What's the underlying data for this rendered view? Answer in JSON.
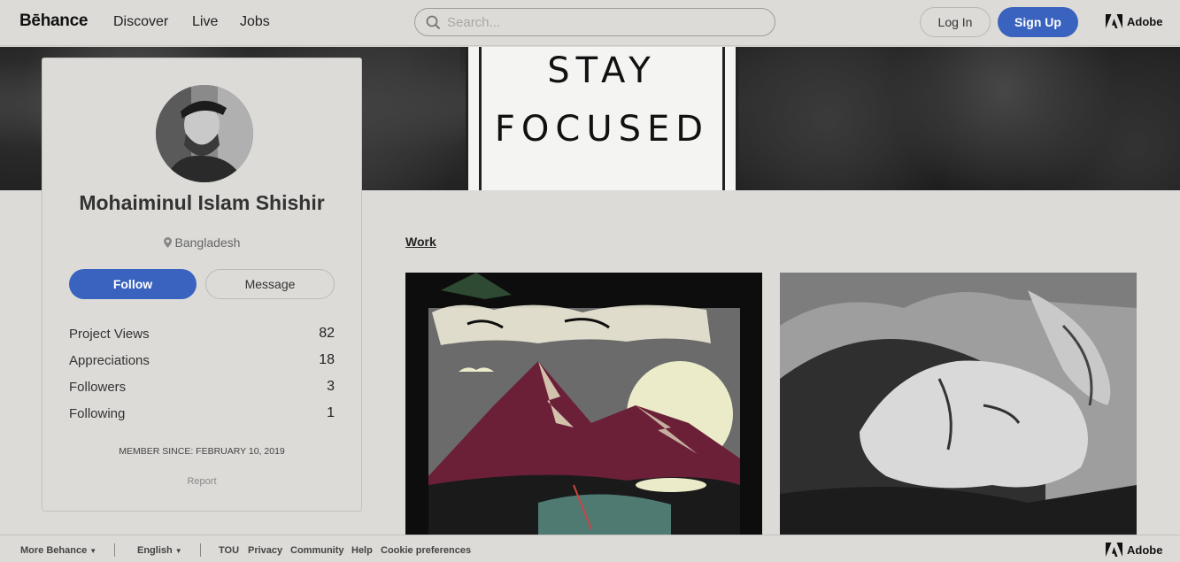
{
  "nav": {
    "logo": "Bēhance",
    "links": [
      "Discover",
      "Live",
      "Jobs"
    ],
    "search_placeholder": "Search...",
    "login": "Log In",
    "signup": "Sign Up",
    "adobe": "Adobe"
  },
  "banner": {
    "line1": "STAY",
    "line2": "FOCUSED"
  },
  "profile": {
    "name": "Mohaiminul Islam Shishir",
    "location": "Bangladesh",
    "follow": "Follow",
    "message": "Message",
    "stats": [
      {
        "label": "Project Views",
        "value": "82"
      },
      {
        "label": "Appreciations",
        "value": "18"
      },
      {
        "label": "Followers",
        "value": "3"
      },
      {
        "label": "Following",
        "value": "1"
      }
    ],
    "member_since": "MEMBER SINCE: FEBRUARY 10, 2019",
    "report": "Report"
  },
  "work": {
    "tab": "Work"
  },
  "footer": {
    "more": "More Behance",
    "language": "English",
    "links": [
      "TOU",
      "Privacy",
      "Community",
      "Help",
      "Cookie preferences"
    ],
    "adobe": "Adobe"
  },
  "colors": {
    "accent": "#3a63bf",
    "background": "#dcdbd8"
  }
}
